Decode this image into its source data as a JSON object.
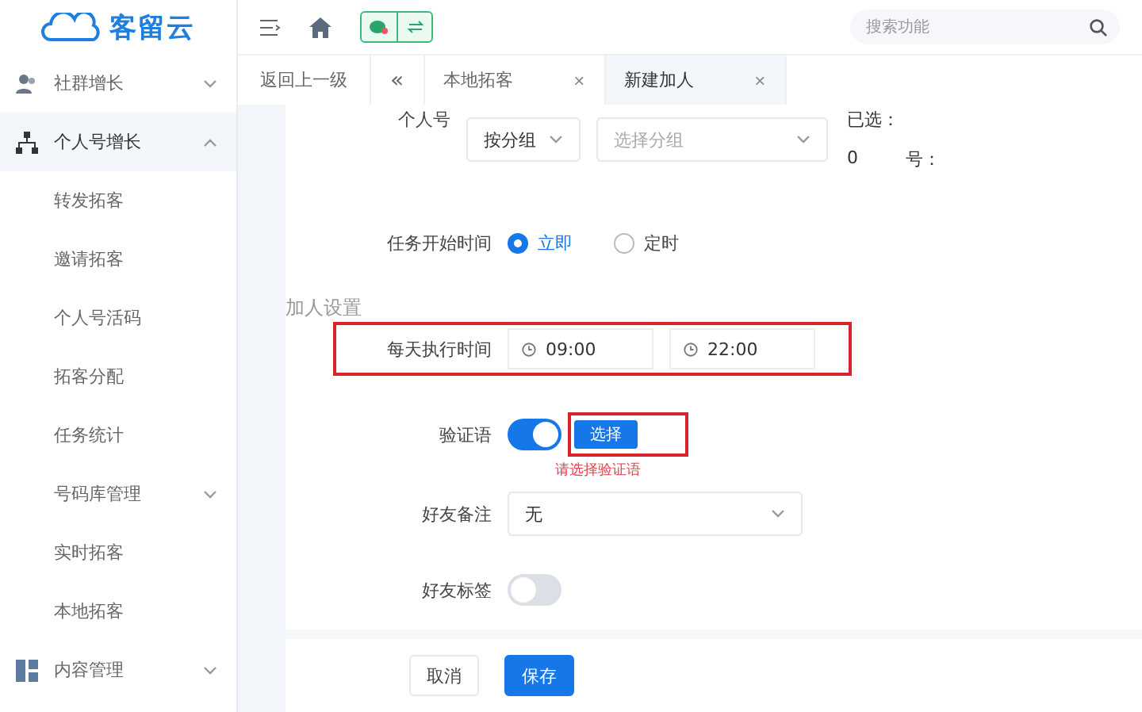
{
  "logo": {
    "text": "客留云"
  },
  "search": {
    "placeholder": "搜索功能"
  },
  "sidebar": {
    "items": [
      {
        "label": "社群增长",
        "expanded": false,
        "selected": false
      },
      {
        "label": "个人号增长",
        "expanded": true,
        "selected": true,
        "children": [
          {
            "label": "转发拓客"
          },
          {
            "label": "邀请拓客"
          },
          {
            "label": "个人号活码"
          },
          {
            "label": "拓客分配"
          },
          {
            "label": "任务统计"
          },
          {
            "label": "号码库管理",
            "expandable": true
          },
          {
            "label": "实时拓客"
          },
          {
            "label": "本地拓客"
          }
        ]
      },
      {
        "label": "内容管理",
        "expanded": false,
        "selected": false
      }
    ]
  },
  "tabs": {
    "back": "返回上一级",
    "collapse": "«",
    "items": [
      {
        "label": "本地拓客",
        "selected": false,
        "close": "×"
      },
      {
        "label": "新建加人",
        "selected": true,
        "close": "×"
      }
    ]
  },
  "form": {
    "account": {
      "label": "个人号",
      "mode": "按分组",
      "group_placeholder": "选择分组",
      "selected_label": "已选：",
      "selected_count": "0",
      "suffix": "号："
    },
    "start_time": {
      "label": "任务开始时间",
      "options": [
        {
          "label": "立即",
          "selected": true
        },
        {
          "label": "定时",
          "selected": false
        }
      ]
    },
    "section": "加人设置",
    "daily_time": {
      "label": "每天执行时间",
      "start": "09:00",
      "end": "22:00",
      "highlighted": true
    },
    "greeting": {
      "label": "验证语",
      "on": true,
      "button": "选择",
      "error": "请选择验证语",
      "highlighted": true
    },
    "remark": {
      "label": "好友备注",
      "value": "无"
    },
    "tag": {
      "label": "好友标签",
      "on": false
    }
  },
  "footer": {
    "buttons": [
      {
        "label": "取消",
        "kind": "secondary"
      },
      {
        "label": "保存",
        "kind": "primary"
      }
    ]
  }
}
